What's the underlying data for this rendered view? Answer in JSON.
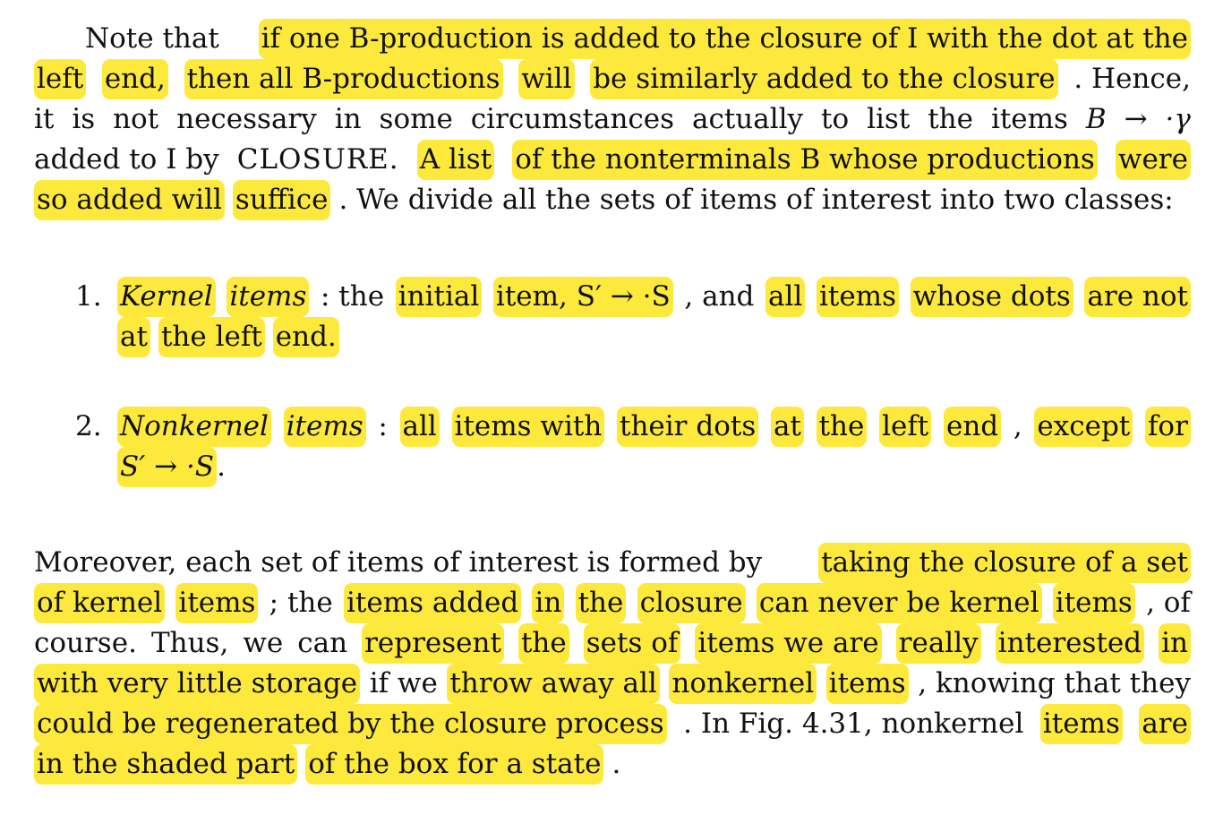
{
  "paragraph1": {
    "line1": [
      "Note that",
      "if one B-production is added to the closure of I with the dot at the"
    ],
    "line2": [
      "left",
      "end,",
      "then all B-productions",
      "will",
      "be similarly added to the closure",
      ". Hence,"
    ],
    "line3": [
      "it",
      "is",
      "not",
      "necessary",
      "in",
      "some",
      "circumstances",
      "actually",
      "to",
      "list",
      "the",
      "items",
      "B",
      "→",
      "·γ"
    ],
    "line4": [
      "added to I by",
      "CLOSURE.",
      "A list",
      "of the nonterminals B whose productions",
      "were"
    ],
    "line5": [
      "so added will",
      "suffice",
      ". We divide all the sets of items of interest into two classes:"
    ]
  },
  "list": [
    {
      "number": "1.",
      "line1": [
        "Kernel",
        "items",
        ": the",
        "initial",
        "item, S′ → ·S",
        ", and",
        "all",
        "items",
        "whose dots",
        "are not"
      ],
      "line2": [
        "at",
        "the left",
        "end."
      ]
    },
    {
      "number": "2.",
      "line1": [
        "Nonkernel",
        "items",
        ":",
        "all",
        "items with",
        "their dots",
        "at",
        "the",
        "left",
        "end",
        ",",
        "except",
        "for"
      ],
      "line2": [
        "S′ → ·S",
        "."
      ]
    }
  ],
  "paragraph2": {
    "line1": [
      "Moreover, each set of items of interest is formed by",
      "taking the closure of a set"
    ],
    "line2": [
      "of kernel",
      "items",
      "; the",
      "items added",
      "in",
      "the",
      "closure",
      "can never be kernel",
      "items",
      ", of"
    ],
    "line3": [
      "course.",
      "Thus,",
      "we",
      "can",
      "represent",
      "the",
      "sets of",
      "items we are",
      "really",
      "interested",
      "in"
    ],
    "line4": [
      "with very little storage",
      "if we",
      "throw away all",
      "nonkernel",
      "items",
      ", knowing that they"
    ],
    "line5": [
      "could be regenerated by the closure process",
      ". In Fig. 4.31, nonkernel",
      "items",
      "are"
    ],
    "line6": [
      "in the shaded part",
      "of the box for a state",
      "."
    ]
  }
}
